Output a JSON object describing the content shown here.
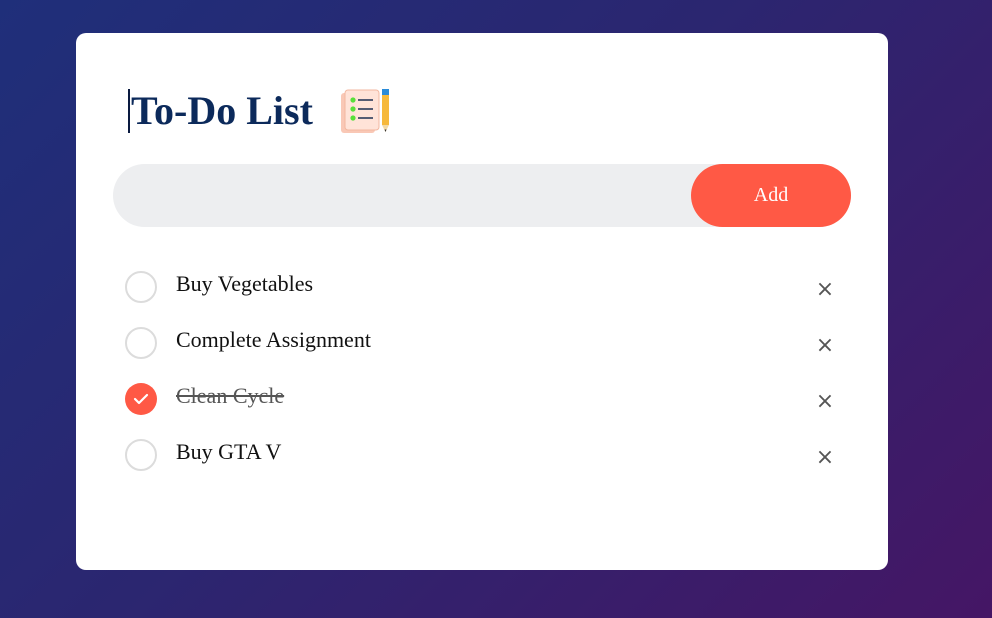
{
  "app": {
    "title": "To-Do List",
    "title_icon": "checklist-notepad-pencil-icon"
  },
  "input": {
    "value": "",
    "placeholder": ""
  },
  "add_button": {
    "label": "Add"
  },
  "tasks": [
    {
      "text": "Buy Vegetables",
      "checked": false
    },
    {
      "text": "Complete Assignment",
      "checked": false
    },
    {
      "text": "Clean Cycle",
      "checked": true
    },
    {
      "text": "Buy GTA V",
      "checked": false
    }
  ],
  "delete_icon": "×",
  "colors": {
    "accent": "#ff5945",
    "title": "#0c2a5b",
    "input_bg": "#edeef0",
    "background_start": "#1f2f7a",
    "background_end": "#451665"
  }
}
